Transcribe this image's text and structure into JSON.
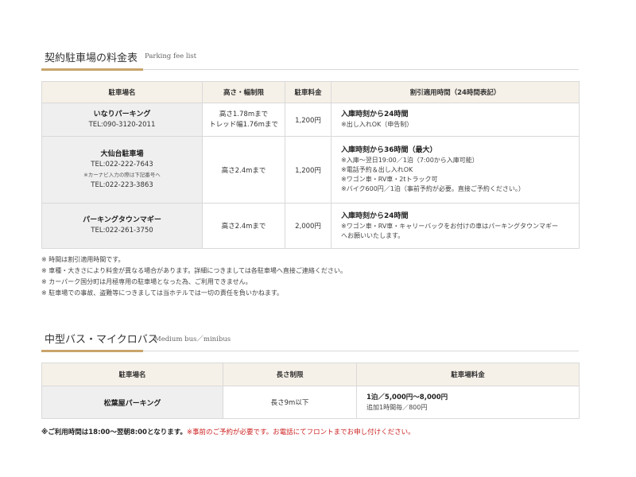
{
  "section1": {
    "title_ja": "契約駐車場の料金表",
    "title_en": "Parking fee list",
    "headers": [
      "駐車場名",
      "高さ・幅制限",
      "駐車料金",
      "割引適用時間（24時間表記）"
    ],
    "rows": [
      {
        "name": "いなりパーキング",
        "tel": "TEL:090-3120-2011",
        "limit": [
          "高さ1.78mまで",
          "トレッド幅1.76mまで"
        ],
        "fee": "1,200円",
        "discount_main": "入庫時刻から24時間",
        "discount_notes": [
          "※出し入れOK（申告制）"
        ]
      },
      {
        "name": "大仙台駐車場",
        "tel": "TEL:022-222-7643",
        "note": "※カーナビ入力の際は下記番号へ",
        "tel2": "TEL:022-223-3863",
        "limit": [
          "高さ2.4mまで"
        ],
        "fee": "1,200円",
        "discount_main": "入庫時刻から36時間（最大）",
        "discount_notes": [
          "※入庫～翌日19:00／1泊（7:00から入庫可能）",
          "※電話予約＆出し入れOK",
          "※ワゴン車・RV車・2tトラック可",
          "※バイク600円／1泊（事前予約が必要。直接ご予約ください。）"
        ]
      },
      {
        "name": "パーキングタウンマギー",
        "tel": "TEL:022-261-3750",
        "limit": [
          "高さ2.4mまで"
        ],
        "fee": "2,000円",
        "discount_main": "入庫時刻から24時間",
        "discount_notes": [
          "※ワゴン車・RV車・キャリーバックをお付けの車はパーキングタウンマギー",
          "へお願いいたします。"
        ]
      }
    ],
    "notes": [
      "※ 時間は割引適用時間です。",
      "※ 車種・大きさにより料金が異なる場合があります。詳細につきましては各駐車場へ直接ご連絡ください。",
      "※ カーパーク国分町は月極専用の駐車場となった為、ご利用できません。",
      "※ 駐車場での事故、盗難等につきましては当ホテルでは一切の責任を負いかねます。"
    ]
  },
  "section2": {
    "title_ja": "中型バス・マイクロバス",
    "title_en": "Medium bus／minibus",
    "headers": [
      "駐車場名",
      "長さ制限",
      "駐車場料金"
    ],
    "row": {
      "name": "松葉屋パーキング",
      "limit": "長さ9m以下",
      "fee_main": "1泊／5,000円～8,000円",
      "fee_sub": "追加1時間毎／800円"
    }
  },
  "footer": {
    "bold_text": "※ご利用時間は18:00～翌朝8:00となります。",
    "red_text": "※事前のご予約が必要です。お電話にてフロントまでお申し付けください。"
  },
  "colors": {
    "accent": "#c9a46a",
    "header_bg": "#f6f1e8",
    "name_bg": "#efefef",
    "warning": "#cc2020"
  }
}
